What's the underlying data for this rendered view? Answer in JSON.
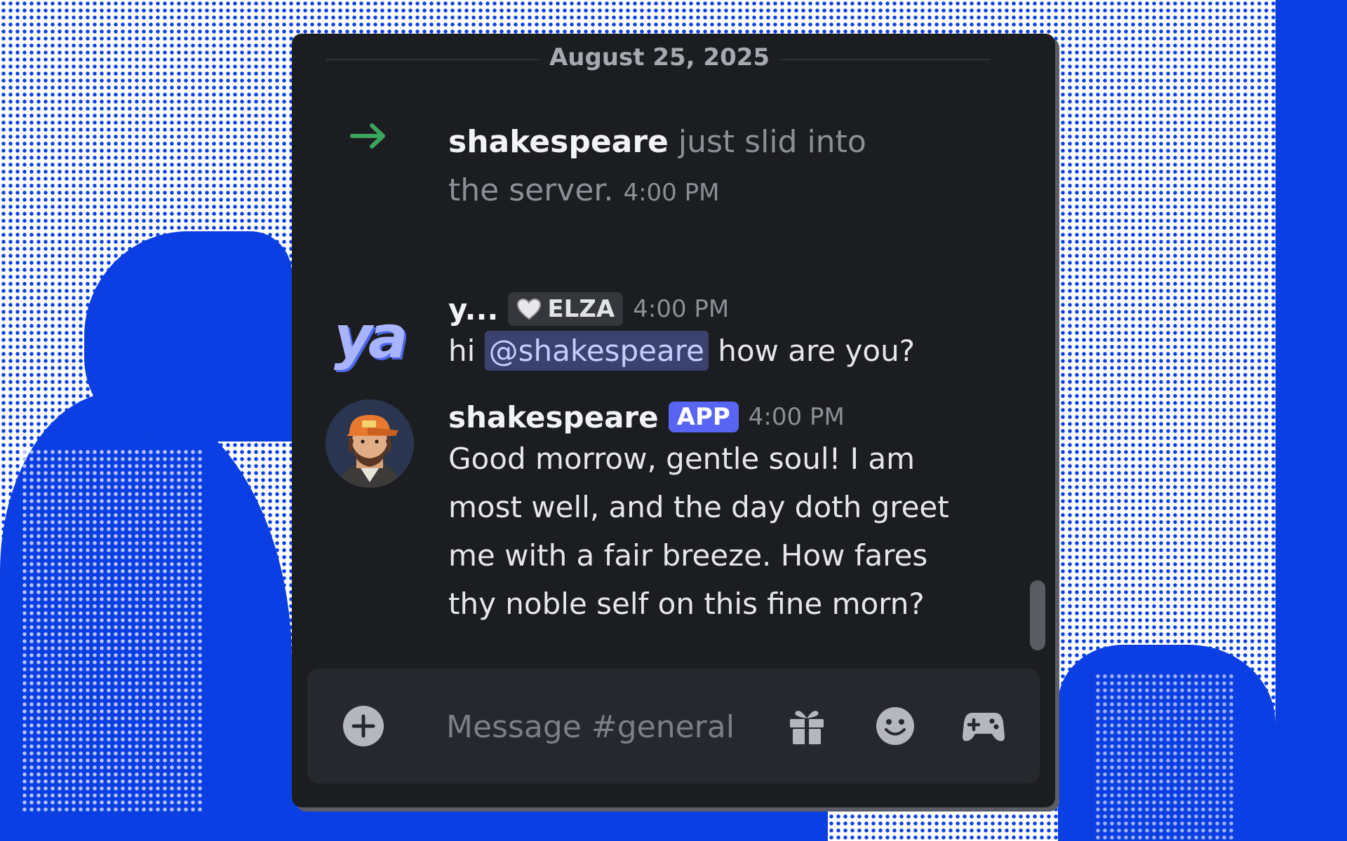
{
  "chat": {
    "date_divider": "August 25, 2025",
    "join_event": {
      "username": "shakespeare",
      "text": "just slid into the server.",
      "timestamp": "4:00 PM"
    },
    "messages": [
      {
        "author": "y...",
        "avatar_text": "ya",
        "role_tag": "ELZA",
        "timestamp": "4:00 PM",
        "text_before": "hi",
        "mention": "@shakespeare",
        "text_after": "how are you?"
      },
      {
        "author": "shakespeare",
        "app_tag": "APP",
        "timestamp": "4:00 PM",
        "text": "Good morrow, gentle soul! I am most well, and the day doth greet me with a fair breeze. How fares thy noble self on this fine morn?"
      }
    ]
  },
  "composer": {
    "placeholder": "Message #general",
    "icons": [
      "add-icon",
      "gift-icon",
      "emoji-icon",
      "gamepad-icon"
    ]
  },
  "colors": {
    "background_blue": "#0b3fe3",
    "window_bg": "#1c1d21",
    "accent": "#5865f2",
    "join_arrow": "#3ba55c",
    "mention_bg": "#3c4270"
  }
}
